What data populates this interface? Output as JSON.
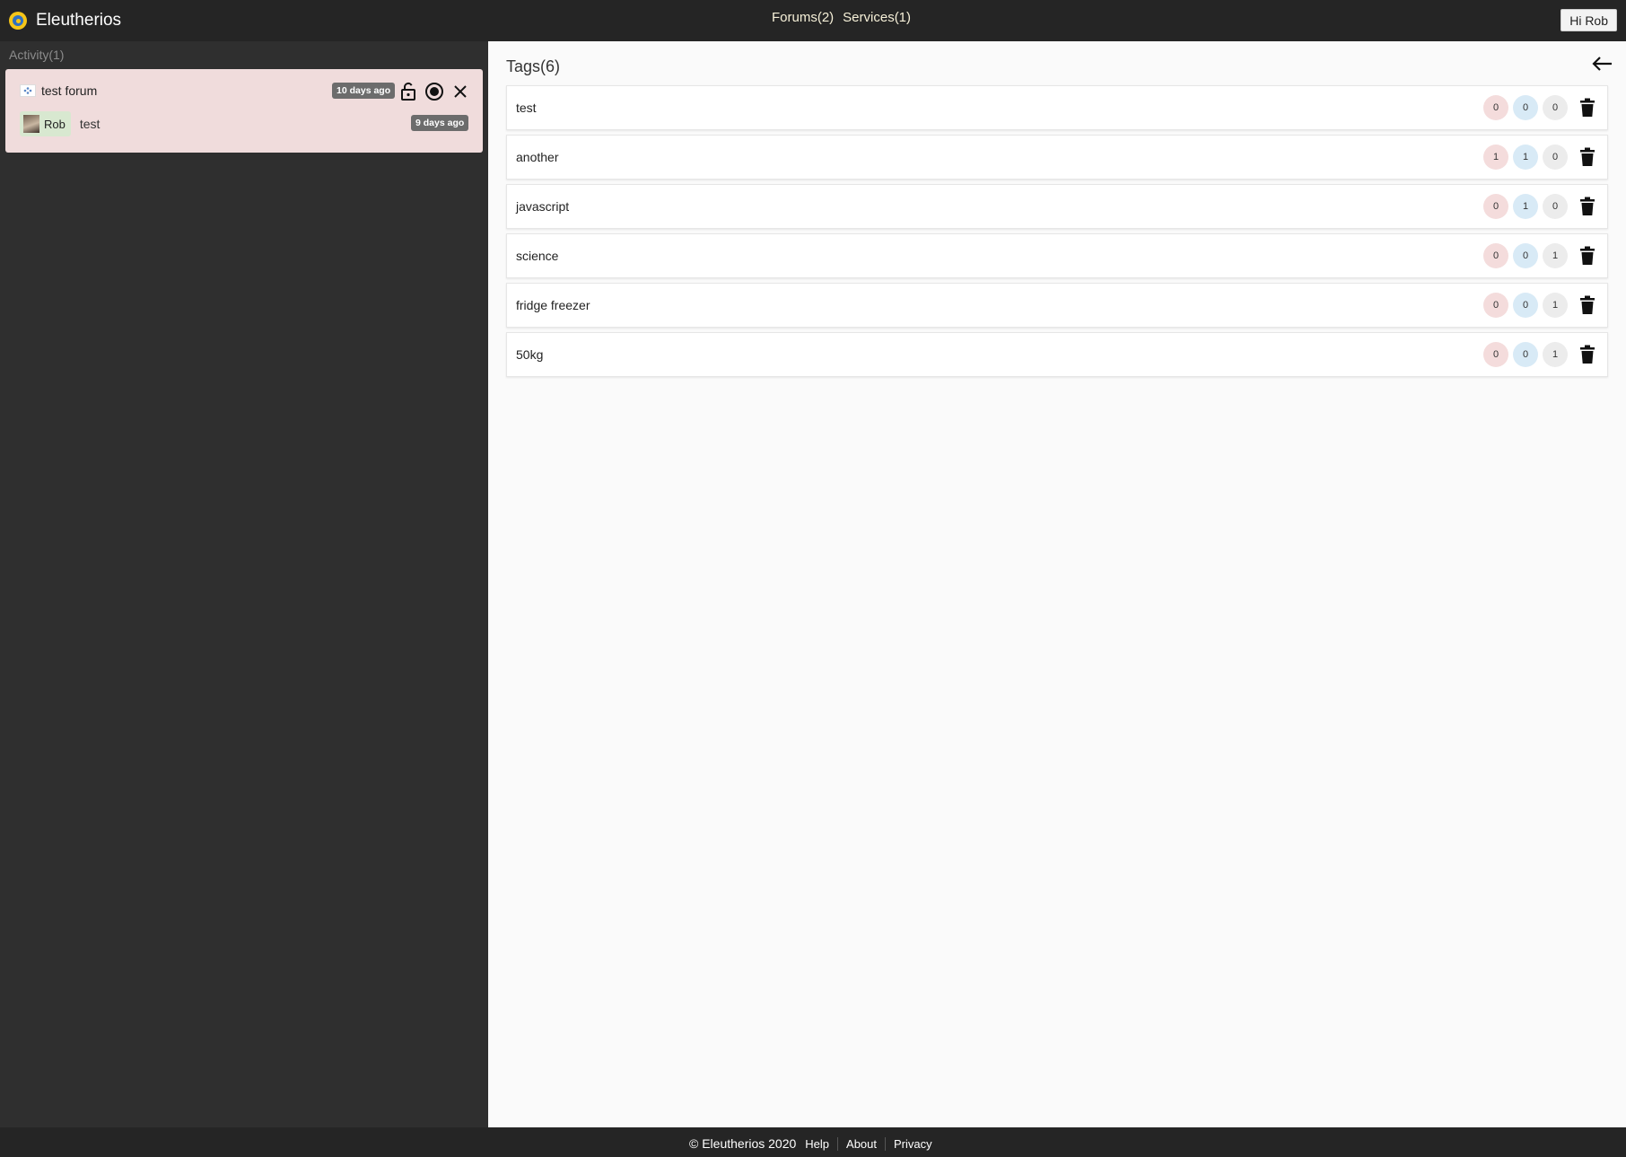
{
  "app": {
    "name": "Eleutherios",
    "accent": "#f5c518",
    "logo_inner": "#2f6fc1"
  },
  "nav": {
    "forums": "Forums(2)",
    "services": "Services(1)",
    "greeting": "Hi Rob"
  },
  "sidebar": {
    "title": "Activity(1)",
    "activity": {
      "forum_name": "test forum",
      "forum_time": "10 days ago",
      "icons": [
        "unlock-icon",
        "record-icon",
        "close-icon"
      ],
      "author": "Rob",
      "post_text": "test",
      "post_time": "9 days ago"
    }
  },
  "main": {
    "title": "Tags(6)",
    "tags": [
      {
        "name": "test",
        "counts": [
          "0",
          "0",
          "0"
        ]
      },
      {
        "name": "another",
        "counts": [
          "1",
          "1",
          "0"
        ]
      },
      {
        "name": "javascript",
        "counts": [
          "0",
          "1",
          "0"
        ]
      },
      {
        "name": "science",
        "counts": [
          "0",
          "0",
          "1"
        ]
      },
      {
        "name": "fridge freezer",
        "counts": [
          "0",
          "0",
          "1"
        ]
      },
      {
        "name": "50kg",
        "counts": [
          "0",
          "0",
          "1"
        ]
      }
    ]
  },
  "footer": {
    "copyright": "© Eleutherios 2020",
    "links": [
      "Help",
      "About",
      "Privacy"
    ]
  }
}
